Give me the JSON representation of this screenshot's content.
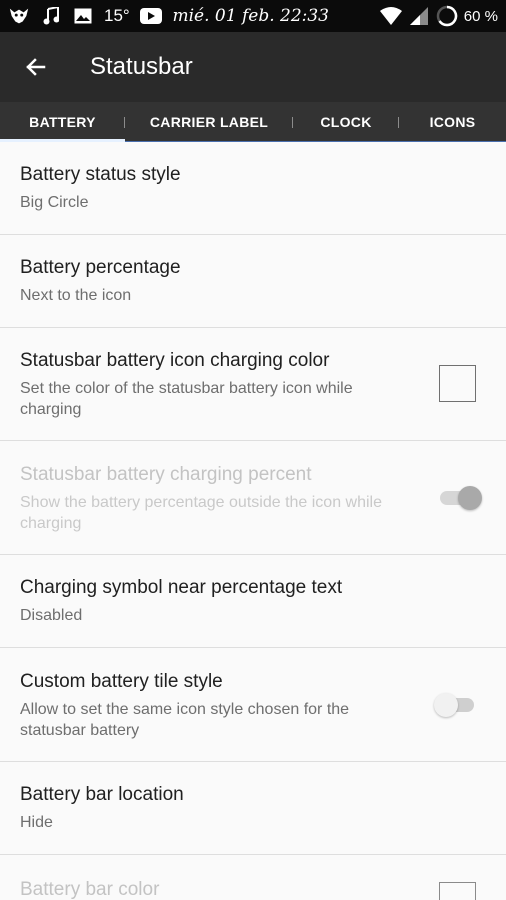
{
  "status_bar": {
    "temperature": "15°",
    "datetime": "mié. 01 feb. 22:33",
    "battery_percent": "60 %"
  },
  "toolbar": {
    "title": "Statusbar"
  },
  "tabs": [
    {
      "label": "BATTERY",
      "active": true
    },
    {
      "label": "CARRIER LABEL",
      "active": false
    },
    {
      "label": "CLOCK",
      "active": false
    },
    {
      "label": "ICONS",
      "active": false
    }
  ],
  "preferences": [
    {
      "title": "Battery status style",
      "summary": "Big Circle",
      "widget": "none",
      "enabled": true
    },
    {
      "title": "Battery percentage",
      "summary": "Next to the icon",
      "widget": "none",
      "enabled": true
    },
    {
      "title": "Statusbar battery icon charging color",
      "summary": "Set the color of the statusbar battery icon while charging",
      "widget": "color-checkbox",
      "enabled": true
    },
    {
      "title": "Statusbar battery charging percent",
      "summary": "Show the battery percentage outside the icon while charging",
      "widget": "switch",
      "checked": true,
      "enabled": false
    },
    {
      "title": "Charging symbol near percentage text",
      "summary": "Disabled",
      "widget": "none",
      "enabled": true
    },
    {
      "title": "Custom battery tile style",
      "summary": "Allow to set the same icon style chosen for the statusbar battery",
      "widget": "switch",
      "checked": false,
      "enabled": true
    },
    {
      "title": "Battery bar location",
      "summary": "Hide",
      "widget": "none",
      "enabled": true
    },
    {
      "title": "Battery bar color",
      "summary": "",
      "widget": "color-checkbox",
      "enabled": false
    }
  ],
  "colors": {
    "status_bar_bg": "#0b0b0b",
    "toolbar_bg": "#2a2a2a",
    "tabs_bg": "#333333",
    "list_bg": "#fafafa",
    "divider": "#dedede",
    "switch_on_disabled_track": "#d6d6d6",
    "switch_on_disabled_thumb": "#a9a9a9",
    "switch_off_track": "#cfcfcf",
    "switch_off_thumb": "#f1f1f1"
  },
  "icons": {
    "status_left": [
      "app-logo-icon",
      "music-note-icon",
      "image-icon",
      "video-icon"
    ],
    "status_right": [
      "wifi-icon",
      "cellular-signal-icon",
      "battery-circle-icon"
    ],
    "toolbar": "back-arrow-icon"
  }
}
